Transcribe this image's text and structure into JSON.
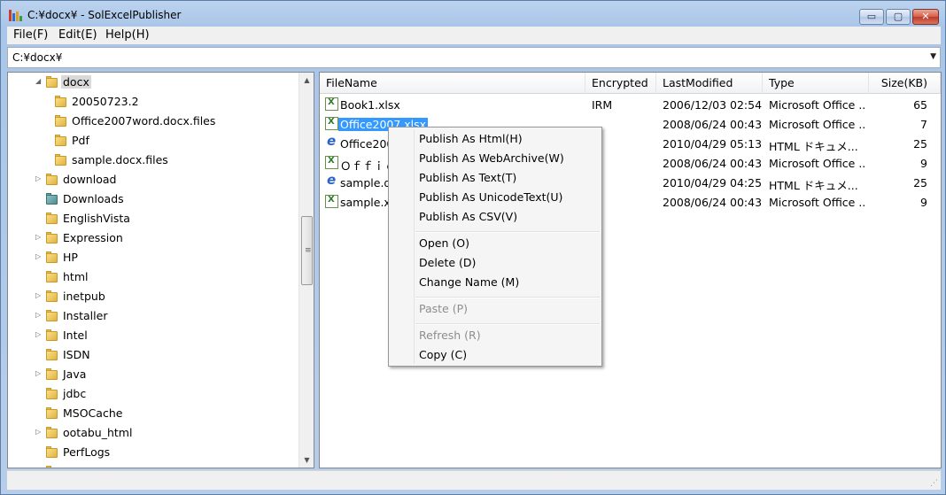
{
  "window": {
    "title": "C:¥docx¥ - SolExcelPublisher",
    "app_icon": "bar-chart-icon",
    "buttons": {
      "minimize": "▭",
      "maximize": "▢",
      "close": "✕"
    }
  },
  "menu": {
    "file": "File(F)",
    "edit": "Edit(E)",
    "help": "Help(H)"
  },
  "path": {
    "value": "C:¥docx¥",
    "dropdown_icon": "▼"
  },
  "tree": {
    "items": [
      {
        "label": "docx"
      },
      {
        "label": "20050723.2"
      },
      {
        "label": "Office2007word.docx.files"
      },
      {
        "label": "Pdf"
      },
      {
        "label": "sample.docx.files"
      },
      {
        "label": "download"
      },
      {
        "label": "Downloads"
      },
      {
        "label": "EnglishVista"
      },
      {
        "label": "Expression"
      },
      {
        "label": "HP"
      },
      {
        "label": "html"
      },
      {
        "label": "inetpub"
      },
      {
        "label": "Installer"
      },
      {
        "label": "Intel"
      },
      {
        "label": "ISDN"
      },
      {
        "label": "Java"
      },
      {
        "label": "jdbc"
      },
      {
        "label": "MSOCache"
      },
      {
        "label": "ootabu_html"
      },
      {
        "label": "PerfLogs"
      }
    ],
    "scroll_up": "▲",
    "scroll_down": "▼",
    "grip": "≡"
  },
  "list": {
    "columns": [
      "FileName",
      "Encrypted",
      "LastModified",
      "Type",
      "Size(KB)"
    ],
    "rows": [
      {
        "name": "Book1.xlsx",
        "encrypted": "IRM",
        "modified": "2006/12/03 02:54",
        "type": "Microsoft Office ...",
        "size": "65"
      },
      {
        "name": "Office2007.xlsx",
        "encrypted": "",
        "modified": "2008/06/24 00:43",
        "type": "Microsoft Office ...",
        "size": "7"
      },
      {
        "name": "Office200",
        "encrypted": "",
        "modified": "2010/04/29 05:13",
        "type": "HTML ドキュメ...",
        "size": "25"
      },
      {
        "name": "Ｏｆｆｉｃ",
        "encrypted": "",
        "modified": "2008/06/24 00:43",
        "type": "Microsoft Office ...",
        "size": "9"
      },
      {
        "name": "sample.do",
        "encrypted": "",
        "modified": "2010/04/29 04:25",
        "type": "HTML ドキュメ...",
        "size": "25"
      },
      {
        "name": "sample.x",
        "encrypted": "",
        "modified": "2008/06/24 00:43",
        "type": "Microsoft Office ...",
        "size": "9"
      }
    ]
  },
  "context_menu": {
    "publish_html": "Publish As Html(H)",
    "publish_webarchive": "Publish As WebArchive(W)",
    "publish_text": "Publish As Text(T)",
    "publish_unicodetext": "Publish As UnicodeText(U)",
    "publish_csv": "Publish As CSV(V)",
    "open": "Open (O)",
    "delete": "Delete (D)",
    "change_name": "Change Name (M)",
    "paste": "Paste (P)",
    "refresh": "Refresh (R)",
    "copy": "Copy (C)"
  }
}
